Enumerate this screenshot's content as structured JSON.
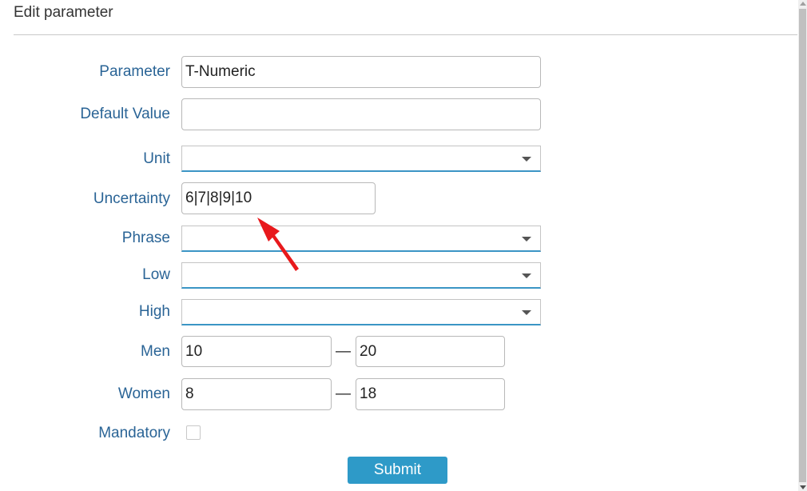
{
  "header": {
    "title": "Edit parameter"
  },
  "form": {
    "parameter": {
      "label": "Parameter",
      "value": "T-Numeric"
    },
    "default_value": {
      "label": "Default Value",
      "value": ""
    },
    "unit": {
      "label": "Unit",
      "selected": ""
    },
    "uncertainty": {
      "label": "Uncertainty",
      "value": "6|7|8|9|10"
    },
    "phrase": {
      "label": "Phrase",
      "selected": ""
    },
    "low": {
      "label": "Low",
      "selected": ""
    },
    "high": {
      "label": "High",
      "selected": ""
    },
    "men": {
      "label": "Men",
      "min": "10",
      "max": "20",
      "separator": "—"
    },
    "women": {
      "label": "Women",
      "min": "8",
      "max": "18",
      "separator": "—"
    },
    "mandatory": {
      "label": "Mandatory",
      "checked": false
    },
    "submit_label": "Submit"
  },
  "colors": {
    "label": "#2a6496",
    "accent": "#2e9ac8",
    "annotation_arrow": "#e8191c"
  }
}
